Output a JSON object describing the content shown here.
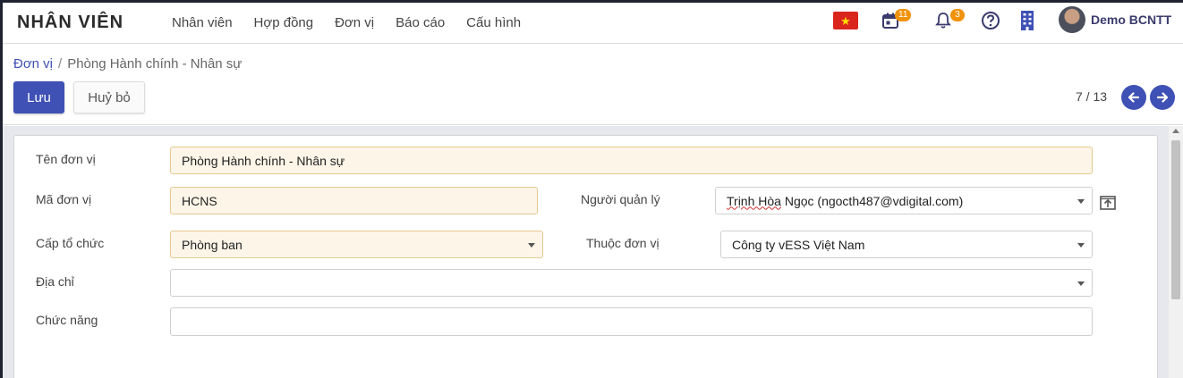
{
  "app": {
    "title": "NHÂN VIÊN"
  },
  "nav": {
    "menu": [
      "Nhân viên",
      "Hợp đồng",
      "Đơn vị",
      "Báo cáo",
      "Cấu hình"
    ],
    "flag_star": "★",
    "calendar_badge": "11",
    "bell_badge": "3",
    "user_name": "Demo BCNTT"
  },
  "breadcrumb": {
    "root": "Đơn vị",
    "separator": "/",
    "current": "Phòng Hành chính - Nhân sự"
  },
  "toolbar": {
    "save_label": "Lưu",
    "cancel_label": "Huỷ bỏ",
    "pager": "7 / 13"
  },
  "form": {
    "ten_don_vi": {
      "label": "Tên đơn vị",
      "value": "Phòng Hành chính - Nhân sự"
    },
    "ma_don_vi": {
      "label": "Mã đơn vị",
      "value": "HCNS"
    },
    "nguoi_quan_ly": {
      "label": "Người quản lý",
      "value_name": "Trịnh Hòa",
      "value_rest": " Ngọc (ngocth487@vdigital.com)"
    },
    "cap_to_chuc": {
      "label": "Cấp tổ chức",
      "value": "Phòng ban"
    },
    "thuoc_don_vi": {
      "label": "Thuộc đơn vị",
      "value": "Công ty vESS Việt Nam"
    },
    "dia_chi": {
      "label": "Địa chỉ",
      "value": ""
    },
    "chuc_nang": {
      "label": "Chức năng",
      "value": ""
    }
  },
  "colors": {
    "primary": "#3f51b5",
    "badge": "#f0920a",
    "required_bg": "#fdf5e8",
    "flag_red": "#da251d"
  }
}
